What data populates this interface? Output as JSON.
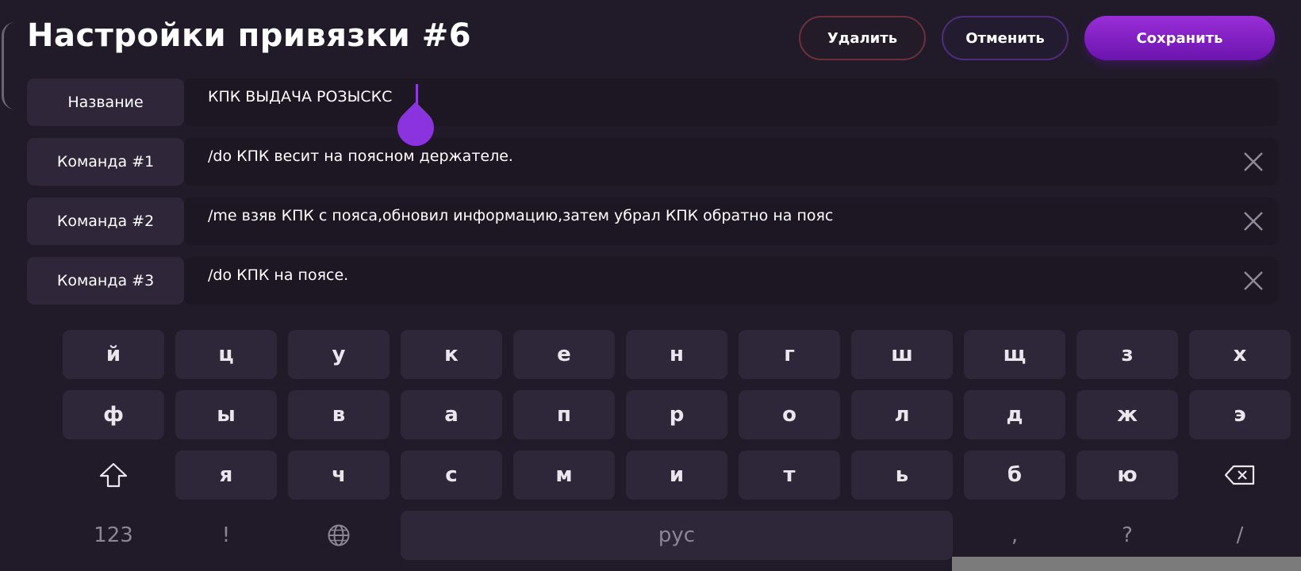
{
  "header": {
    "title": "Настройки привязки #6",
    "delete_label": "Удалить",
    "cancel_label": "Отменить",
    "save_label": "Сохранить"
  },
  "rows": [
    {
      "label": "Название",
      "value": "КПК ВЫДАЧА РОЗЫСКС",
      "clearable": false
    },
    {
      "label": "Команда #1",
      "value": "/do КПК весит на поясном держателе.",
      "clearable": true
    },
    {
      "label": "Команда #2",
      "value": "/me взяв КПК с пояса,обновил информацию,затем убрал КПК обратно на пояс",
      "clearable": true
    },
    {
      "label": "Команда #3",
      "value": "/do КПК на поясе.",
      "clearable": true
    }
  ],
  "keyboard": {
    "row1": [
      "й",
      "ц",
      "у",
      "к",
      "е",
      "н",
      "г",
      "ш",
      "щ",
      "з",
      "х"
    ],
    "row2": [
      "ф",
      "ы",
      "в",
      "а",
      "п",
      "р",
      "о",
      "л",
      "д",
      "ж",
      "э"
    ],
    "row3": [
      "я",
      "ч",
      "с",
      "м",
      "и",
      "т",
      "ь",
      "б",
      "ю"
    ],
    "numbers_label": "123",
    "exclaim_label": "!",
    "space_label": "рус",
    "comma_label": ",",
    "question_label": "?",
    "slash_label": "/"
  },
  "icons": {
    "shift": "shift-icon",
    "backspace": "backspace-icon",
    "language": "globe-icon",
    "clear": "close-icon"
  },
  "colors": {
    "accent": "#8a33de",
    "delete_border": "#6e2f3d",
    "cancel_border": "#4f2d7c"
  }
}
